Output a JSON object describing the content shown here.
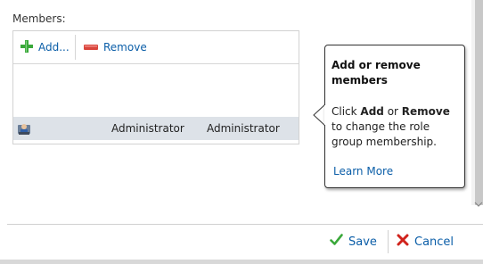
{
  "members": {
    "label": "Members:",
    "toolbar": {
      "add_label": "Add...",
      "remove_label": "Remove"
    },
    "rows": [
      {
        "icon": "user-group-icon",
        "col1": "Administrator",
        "col2": "Administrator"
      }
    ]
  },
  "callout": {
    "title": "Add or remove members",
    "body_prefix": "Click ",
    "body_add": "Add",
    "body_or": " or ",
    "body_remove": "Remove",
    "body_suffix": " to change the role group membership.",
    "link": "Learn More"
  },
  "footer": {
    "save_label": "Save",
    "cancel_label": "Cancel"
  },
  "colors": {
    "link": "#0b5ea8",
    "row_selected": "#dde2e8",
    "add_green": "#3aa83a",
    "remove_red": "#d9453c",
    "cancel_red": "#d0231c"
  }
}
